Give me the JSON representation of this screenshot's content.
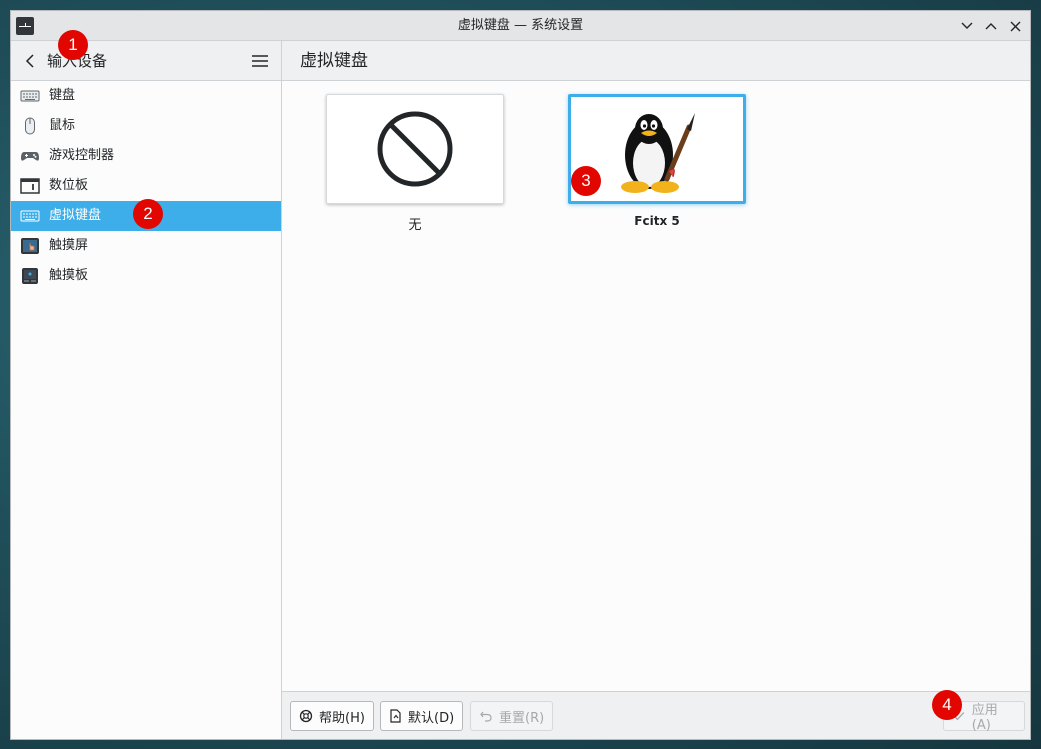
{
  "window": {
    "title": "虚拟键盘 — 系统设置"
  },
  "sidebar": {
    "header": "输入设备",
    "items": [
      {
        "label": "键盘",
        "icon": "keyboard-icon"
      },
      {
        "label": "鼠标",
        "icon": "mouse-icon"
      },
      {
        "label": "游戏控制器",
        "icon": "gamepad-icon"
      },
      {
        "label": "数位板",
        "icon": "tablet-icon"
      },
      {
        "label": "虚拟键盘",
        "icon": "virtual-keyboard-icon",
        "selected": true
      },
      {
        "label": "触摸屏",
        "icon": "touchscreen-icon"
      },
      {
        "label": "触摸板",
        "icon": "touchpad-icon"
      }
    ]
  },
  "main": {
    "title": "虚拟键盘",
    "options": [
      {
        "label": "无",
        "icon": "none-icon"
      },
      {
        "label": "Fcitx 5",
        "icon": "fcitx-penguin-icon",
        "selected": true
      }
    ]
  },
  "footer": {
    "help": "帮助(H)",
    "defaults": "默认(D)",
    "reset": "重置(R)",
    "apply": "应用(A)"
  },
  "badges": [
    "1",
    "2",
    "3",
    "4"
  ],
  "colors": {
    "accent": "#3daee9",
    "badge": "#e10600"
  }
}
